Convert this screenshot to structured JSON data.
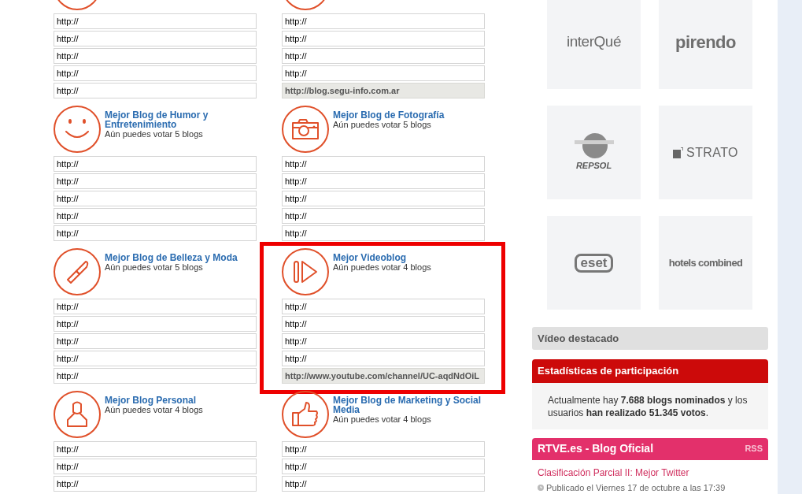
{
  "categories": [
    {
      "fields": [
        {
          "value": "http://",
          "filled": false
        },
        {
          "value": "http://",
          "filled": false
        },
        {
          "value": "http://",
          "filled": false
        },
        {
          "value": "http://",
          "filled": false
        },
        {
          "value": "http://",
          "filled": false
        }
      ]
    },
    {
      "fields": [
        {
          "value": "http://",
          "filled": false
        },
        {
          "value": "http://",
          "filled": false
        },
        {
          "value": "http://",
          "filled": false
        },
        {
          "value": "http://",
          "filled": false
        },
        {
          "value": "http://blog.segu-info.com.ar",
          "filled": true
        }
      ]
    },
    {
      "kind": "smile",
      "title": "Mejor Blog de Humor y Entretenimiento",
      "subtitle": "Aún puedes votar 5 blogs",
      "fields": [
        {
          "value": "http://",
          "filled": false
        },
        {
          "value": "http://",
          "filled": false
        },
        {
          "value": "http://",
          "filled": false
        },
        {
          "value": "http://",
          "filled": false
        },
        {
          "value": "http://",
          "filled": false
        }
      ]
    },
    {
      "kind": "camera",
      "title": "Mejor Blog de Fotografía",
      "subtitle": "Aún puedes votar 5 blogs",
      "fields": [
        {
          "value": "http://",
          "filled": false
        },
        {
          "value": "http://",
          "filled": false
        },
        {
          "value": "http://",
          "filled": false
        },
        {
          "value": "http://",
          "filled": false
        },
        {
          "value": "http://",
          "filled": false
        }
      ]
    },
    {
      "kind": "lipstick",
      "title": "Mejor Blog de Belleza y Moda",
      "subtitle": "Aún puedes votar 5 blogs",
      "fields": [
        {
          "value": "http://",
          "filled": false
        },
        {
          "value": "http://",
          "filled": false
        },
        {
          "value": "http://",
          "filled": false
        },
        {
          "value": "http://",
          "filled": false
        },
        {
          "value": "http://",
          "filled": false
        }
      ]
    },
    {
      "kind": "play",
      "title": "Mejor Videoblog",
      "subtitle": "Aún puedes votar 4 blogs",
      "highlighted": true,
      "fields": [
        {
          "value": "http://",
          "filled": false
        },
        {
          "value": "http://",
          "filled": false
        },
        {
          "value": "http://",
          "filled": false
        },
        {
          "value": "http://",
          "filled": false
        },
        {
          "value": "http://www.youtube.com/channel/UC-aqdNdOiL",
          "filled": true
        }
      ]
    },
    {
      "kind": "person",
      "title": "Mejor Blog Personal",
      "subtitle": "Aún puedes votar 4 blogs",
      "fields": [
        {
          "value": "http://",
          "filled": false
        },
        {
          "value": "http://",
          "filled": false
        },
        {
          "value": "http://",
          "filled": false
        }
      ]
    },
    {
      "kind": "thumbs",
      "title": "Mejor Blog de Marketing y Social Media",
      "subtitle": "Aún puedes votar 4 blogs",
      "fields": [
        {
          "value": "http://",
          "filled": false
        },
        {
          "value": "http://",
          "filled": false
        },
        {
          "value": "http://",
          "filled": false
        }
      ]
    }
  ],
  "sponsors": [
    {
      "kind": "interque",
      "name": "interQué"
    },
    {
      "kind": "pirendo",
      "name": "pirendo"
    },
    {
      "kind": "repsol",
      "name": "REPSOL"
    },
    {
      "kind": "strato",
      "name": "STRATO"
    },
    {
      "kind": "eset",
      "name": "eset"
    },
    {
      "kind": "hotels",
      "name": "hotels combined"
    }
  ],
  "featured_video": {
    "title": "Vídeo destacado"
  },
  "stats": {
    "title": "Estadísticas de participación",
    "text": "Actualmente hay **7.688 blogs nominados** y los usuarios **han realizado 51.345 votos**."
  },
  "blog": {
    "title": "RTVE.es - Blog Oficial",
    "rss": "RSS",
    "post_title": "Clasificación Parcial II: Mejor Twitter",
    "post_date": "Publicado el Viernes 17 de octubre a las 17:39"
  }
}
